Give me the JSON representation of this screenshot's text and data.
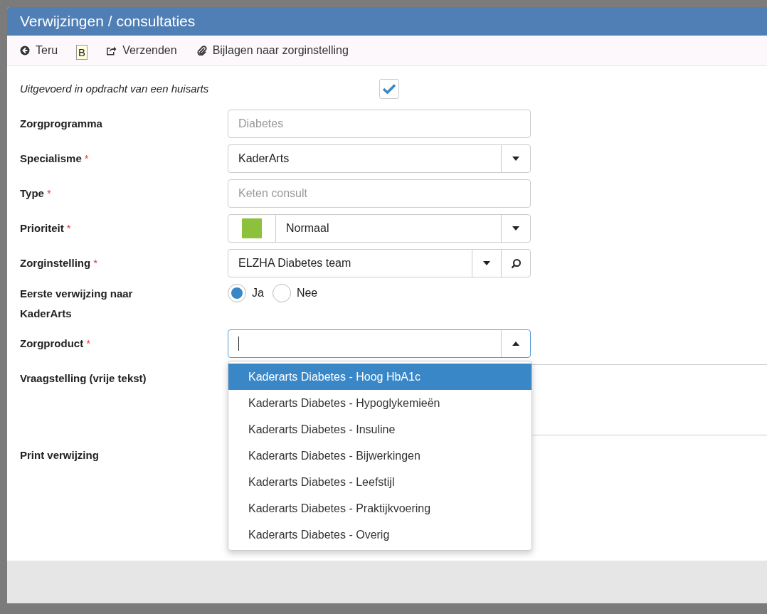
{
  "window": {
    "title": "Verwijzingen / consultaties"
  },
  "toolbar": [
    {
      "kind": "back",
      "label": "Teru"
    },
    {
      "kind": "send",
      "label": "Verzenden"
    },
    {
      "kind": "attach",
      "label": "Bijlagen naar zorginstelling"
    }
  ],
  "tooltip": "B",
  "form": [
    {
      "kind": "checkbox",
      "label": "Uitgevoerd in opdracht van een huisarts",
      "checked": true
    },
    {
      "kind": "text",
      "label": "Zorgprogramma",
      "placeholder": "Diabetes"
    },
    {
      "kind": "select",
      "label": "Specialisme",
      "required_mark": "*",
      "value": "KaderArts"
    },
    {
      "kind": "text",
      "label": "Type",
      "required_mark": "*",
      "placeholder": "Keten consult"
    },
    {
      "kind": "priority",
      "label": "Prioriteit",
      "required_mark": "*",
      "value": "Normaal",
      "color": "#8dc13b"
    },
    {
      "kind": "lookup",
      "label": "Zorginstelling",
      "required_mark": "*",
      "value": "ELZHA Diabetes team"
    },
    {
      "kind": "radio",
      "label": "Eerste verwijzing naar KaderArts",
      "options": [
        {
          "label": "Ja",
          "selected": true
        },
        {
          "label": "Nee",
          "selected": false
        }
      ]
    },
    {
      "kind": "combo",
      "label": "Zorgproduct",
      "required_mark": "*",
      "expanded": true,
      "options": [
        {
          "label": "Kaderarts Diabetes - Hoog HbA1c",
          "selected": true
        },
        {
          "label": "Kaderarts Diabetes - Hypoglykemieën",
          "selected": false
        },
        {
          "label": "Kaderarts Diabetes - Insuline",
          "selected": false
        },
        {
          "label": "Kaderarts Diabetes - Bijwerkingen",
          "selected": false
        },
        {
          "label": "Kaderarts Diabetes - Leefstijl",
          "selected": false
        },
        {
          "label": "Kaderarts Diabetes - Praktijkvoering",
          "selected": false
        },
        {
          "label": "Kaderarts Diabetes - Overig",
          "selected": false
        }
      ]
    },
    {
      "kind": "textarea",
      "label": "Vraagstelling (vrije tekst)"
    },
    {
      "kind": "label",
      "label": "Print verwijzing"
    }
  ]
}
